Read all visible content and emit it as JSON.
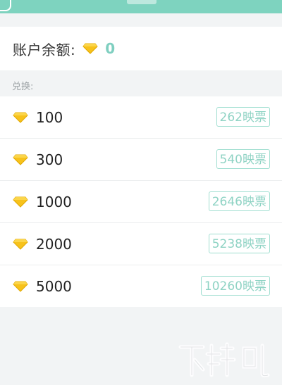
{
  "balance": {
    "label": "账户余额:",
    "value": "0",
    "icon": "diamond-icon"
  },
  "section": {
    "title": "兑换:"
  },
  "exchange": {
    "items": [
      {
        "amount": "100",
        "price": "262映票"
      },
      {
        "amount": "300",
        "price": "540映票"
      },
      {
        "amount": "1000",
        "price": "2646映票"
      },
      {
        "amount": "2000",
        "price": "5238映票"
      },
      {
        "amount": "5000",
        "price": "10260映票"
      }
    ]
  },
  "colors": {
    "accent": "#7ed3bf",
    "gem": "#f5b800",
    "button_text": "#8fd3c4"
  }
}
